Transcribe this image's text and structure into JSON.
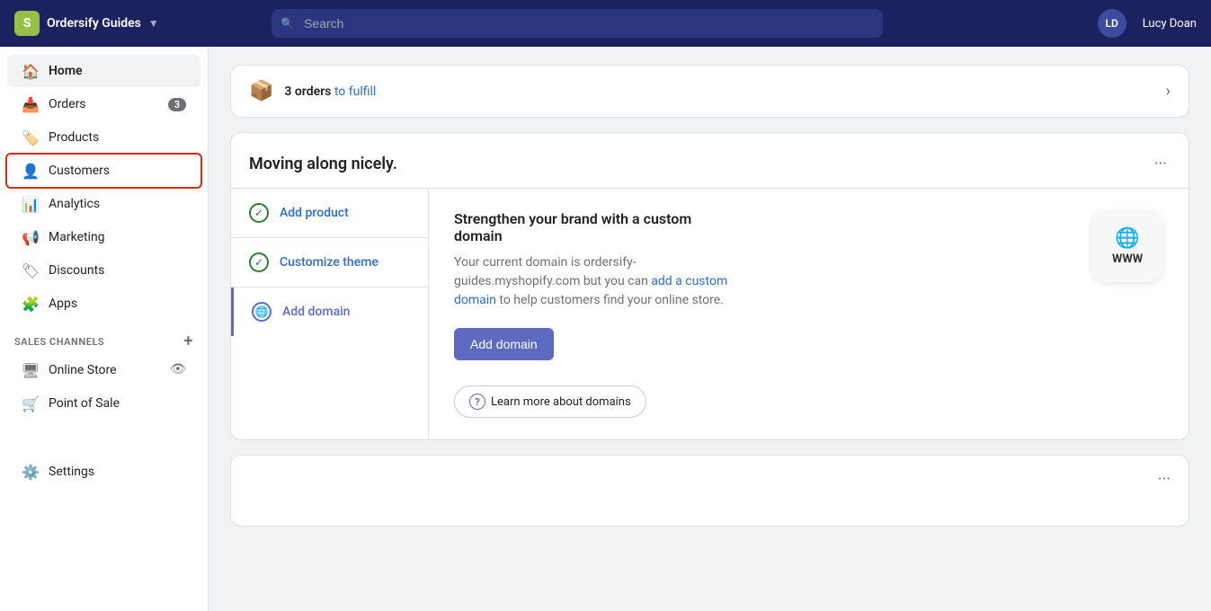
{
  "topnav": {
    "brand": "Ordersify Guides",
    "brand_icon": "S",
    "brand_arrow": "▼",
    "search_placeholder": "Search",
    "avatar_initials": "LD",
    "username": "Lucy Doan"
  },
  "sidebar": {
    "nav_items": [
      {
        "id": "home",
        "label": "Home",
        "icon": "🏠",
        "active": true,
        "badge": null
      },
      {
        "id": "orders",
        "label": "Orders",
        "icon": "📥",
        "active": false,
        "badge": "3"
      },
      {
        "id": "products",
        "label": "Products",
        "icon": "🏷️",
        "active": false,
        "badge": null
      },
      {
        "id": "customers",
        "label": "Customers",
        "icon": "👤",
        "active": false,
        "badge": null,
        "highlighted": true
      },
      {
        "id": "analytics",
        "label": "Analytics",
        "icon": "📊",
        "active": false,
        "badge": null
      },
      {
        "id": "marketing",
        "label": "Marketing",
        "icon": "📢",
        "active": false,
        "badge": null
      },
      {
        "id": "discounts",
        "label": "Discounts",
        "icon": "🏷",
        "active": false,
        "badge": null
      },
      {
        "id": "apps",
        "label": "Apps",
        "icon": "🧩",
        "active": false,
        "badge": null
      }
    ],
    "sales_channels_label": "SALES CHANNELS",
    "sales_channels_items": [
      {
        "id": "online-store",
        "label": "Online Store"
      },
      {
        "id": "point-of-sale",
        "label": "Point of Sale"
      }
    ],
    "settings_label": "Settings"
  },
  "main": {
    "orders_bar": {
      "count": "3 orders",
      "suffix": "to fulfill",
      "icon": "📦"
    },
    "moving_card": {
      "title": "Moving along nicely.",
      "steps": [
        {
          "id": "add-product",
          "label": "Add product",
          "done": true,
          "active": false
        },
        {
          "id": "customize-theme",
          "label": "Customize theme",
          "done": true,
          "active": false
        },
        {
          "id": "add-domain",
          "label": "Add domain",
          "done": false,
          "active": true
        }
      ],
      "domain_panel": {
        "title": "Strengthen your brand with a custom domain",
        "description_part1": "Your current domain is ordersify-guides.myshopify.com but you can ",
        "description_link": "add a custom domain",
        "description_part2": " to help customers find your online store.",
        "button_label": "Add domain",
        "learn_more_label": "Learn more about domains"
      }
    }
  }
}
